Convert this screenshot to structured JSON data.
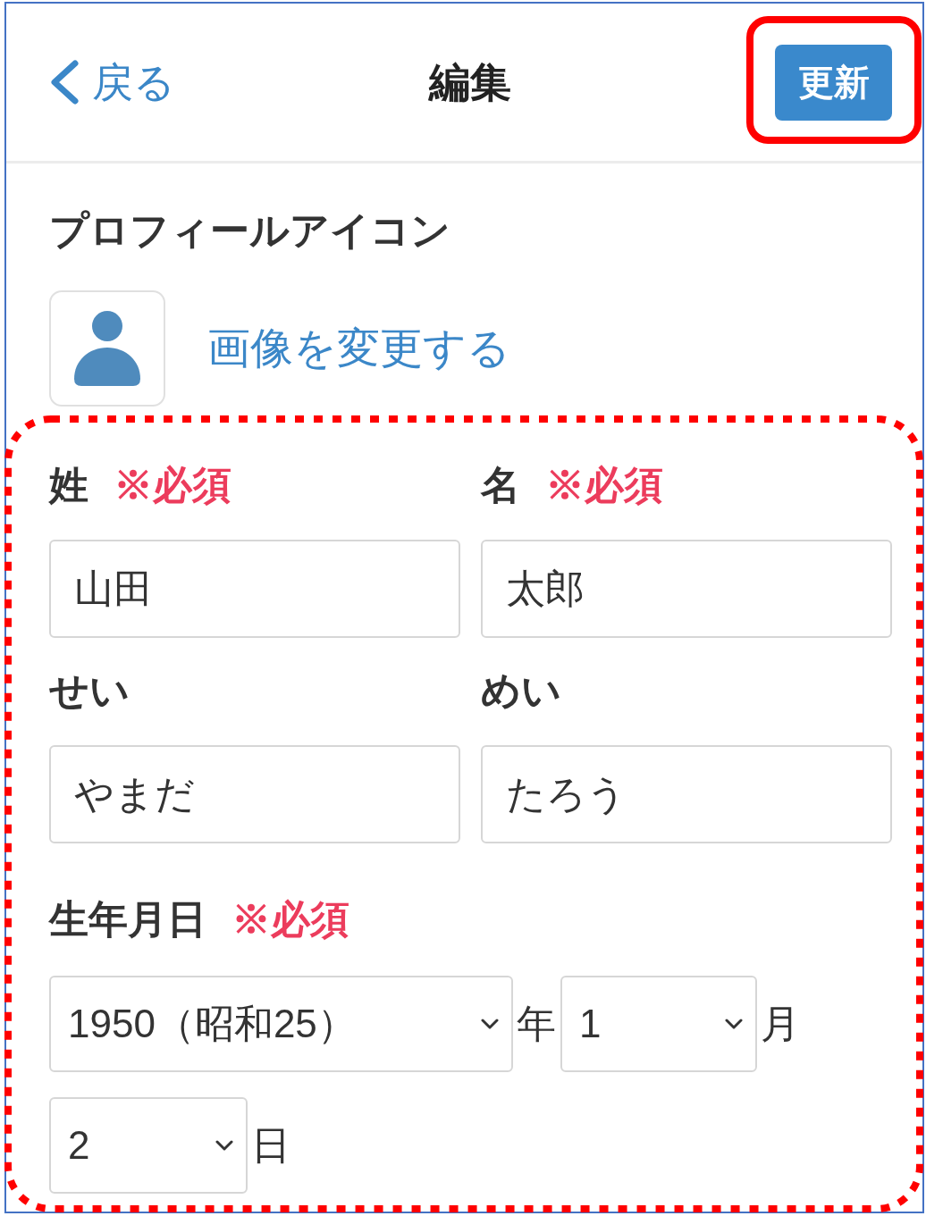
{
  "header": {
    "back_label": "戻る",
    "title": "編集",
    "update_button": "更新"
  },
  "profile_icon": {
    "heading": "プロフィールアイコン",
    "change_link": "画像を変更する"
  },
  "name_fields": [
    {
      "label": "姓",
      "required_mark": "※必須",
      "value": "山田"
    },
    {
      "label": "名",
      "required_mark": "※必須",
      "value": "太郎"
    },
    {
      "label": "せい",
      "value": "やまだ"
    },
    {
      "label": "めい",
      "value": "たろう"
    }
  ],
  "birthdate": {
    "label": "生年月日",
    "required_mark": "※必須",
    "selects": [
      {
        "value": "1950（昭和25）",
        "unit": "年"
      },
      {
        "value": "1",
        "unit": "月"
      },
      {
        "value": "2",
        "unit": "日"
      }
    ]
  }
}
